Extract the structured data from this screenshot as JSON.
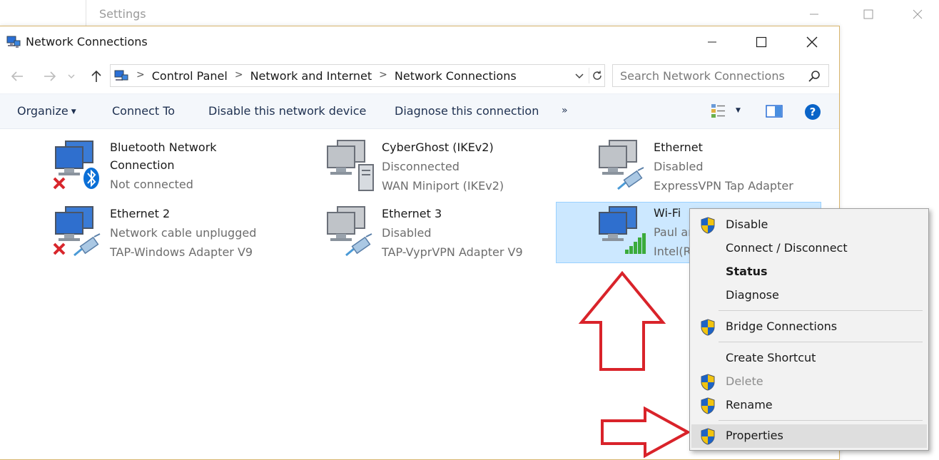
{
  "settings_window": {
    "title": "Settings"
  },
  "window": {
    "title": "Network Connections"
  },
  "address": {
    "crumbs": [
      "Control Panel",
      "Network and Internet",
      "Network Connections"
    ],
    "search_placeholder": "Search Network Connections"
  },
  "toolbar": {
    "organize": "Organize",
    "connect_to": "Connect To",
    "disable": "Disable this network device",
    "diagnose": "Diagnose this connection",
    "more": "»"
  },
  "connections": [
    {
      "name": "Bluetooth Network",
      "name2": "Connection",
      "status": "Not connected",
      "device": "",
      "icon": "bluetooth-network-icon"
    },
    {
      "name": "CyberGhost (IKEv2)",
      "name2": "",
      "status": "Disconnected",
      "device": "WAN Miniport (IKEv2)",
      "icon": "vpn-network-icon"
    },
    {
      "name": "Ethernet",
      "name2": "",
      "status": "Disabled",
      "device": "ExpressVPN Tap Adapter",
      "icon": "ethernet-network-icon"
    },
    {
      "name": "Ethernet 2",
      "name2": "",
      "status": "Network cable unplugged",
      "device": "TAP-Windows Adapter V9",
      "icon": "ethernet-network-icon"
    },
    {
      "name": "Ethernet 3",
      "name2": "",
      "status": "Disabled",
      "device": "TAP-VyprVPN Adapter V9",
      "icon": "ethernet-network-icon"
    },
    {
      "name": "Wi-Fi",
      "name2": "",
      "status": "Paul ar",
      "device": "Intel(R",
      "icon": "wifi-network-icon"
    }
  ],
  "context_menu": {
    "items": [
      {
        "label": "Disable",
        "shield": true
      },
      {
        "label": "Connect / Disconnect",
        "shield": false
      },
      {
        "label": "Status",
        "shield": false,
        "bold": true
      },
      {
        "label": "Diagnose",
        "shield": false
      },
      {
        "label": "Bridge Connections",
        "shield": true
      },
      {
        "label": "Create Shortcut",
        "shield": false
      },
      {
        "label": "Delete",
        "shield": true,
        "disabled": true
      },
      {
        "label": "Rename",
        "shield": true
      },
      {
        "label": "Properties",
        "shield": true,
        "highlighted": true
      }
    ]
  },
  "colors": {
    "accent": "#0078d7",
    "selection": "#cce8ff",
    "annotation_arrow": "#d9232a"
  }
}
